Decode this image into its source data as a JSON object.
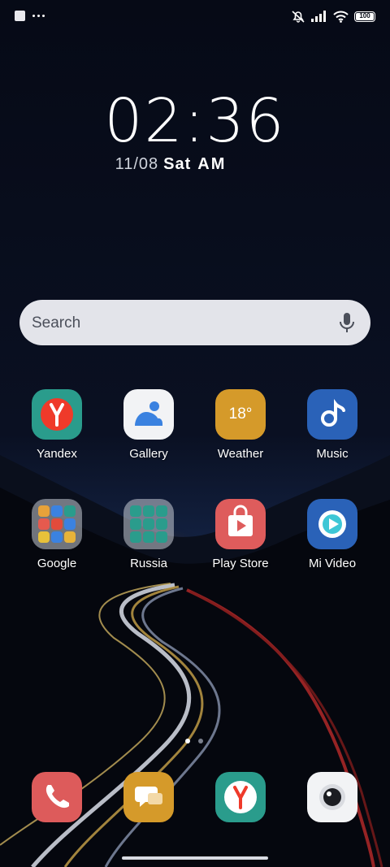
{
  "status_bar": {
    "battery": "100",
    "icons": [
      "notification-square-icon",
      "more-dots-icon",
      "silent-icon",
      "signal-icon",
      "wifi-icon",
      "battery-icon"
    ]
  },
  "clock": {
    "time": "02:36",
    "date": "11/08",
    "weekday": "Sat",
    "ampm": "AM"
  },
  "search": {
    "placeholder": "Search",
    "icon": "mic-icon"
  },
  "apps": [
    {
      "label": "Yandex",
      "icon": "yandex-icon",
      "color": "#2a9c8c"
    },
    {
      "label": "Gallery",
      "icon": "gallery-icon",
      "color": "#f2f3f5"
    },
    {
      "label": "Weather",
      "icon": "weather-icon",
      "color": "#d59a2a",
      "text": "18°"
    },
    {
      "label": "Music",
      "icon": "music-icon",
      "color": "#2a62b8"
    },
    {
      "label": "Google",
      "icon": "google-folder-icon"
    },
    {
      "label": "Russia",
      "icon": "russia-folder-icon"
    },
    {
      "label": "Play Store",
      "icon": "play-store-icon",
      "color": "#de5c5c"
    },
    {
      "label": "Mi Video",
      "icon": "mi-video-icon",
      "color": "#2a62b8"
    }
  ],
  "dock": [
    {
      "icon": "phone-icon",
      "color": "#dd5b5b"
    },
    {
      "icon": "messages-icon",
      "color": "#d59a2a"
    },
    {
      "icon": "yandex-browser-icon",
      "color": "#2a9c8c"
    },
    {
      "icon": "camera-icon",
      "color": "#f2f3f5"
    }
  ],
  "page_indicator": {
    "pages": 2,
    "active": 1
  },
  "colors": {
    "background": "#070b17",
    "search_bg": "#e3e4ea"
  }
}
